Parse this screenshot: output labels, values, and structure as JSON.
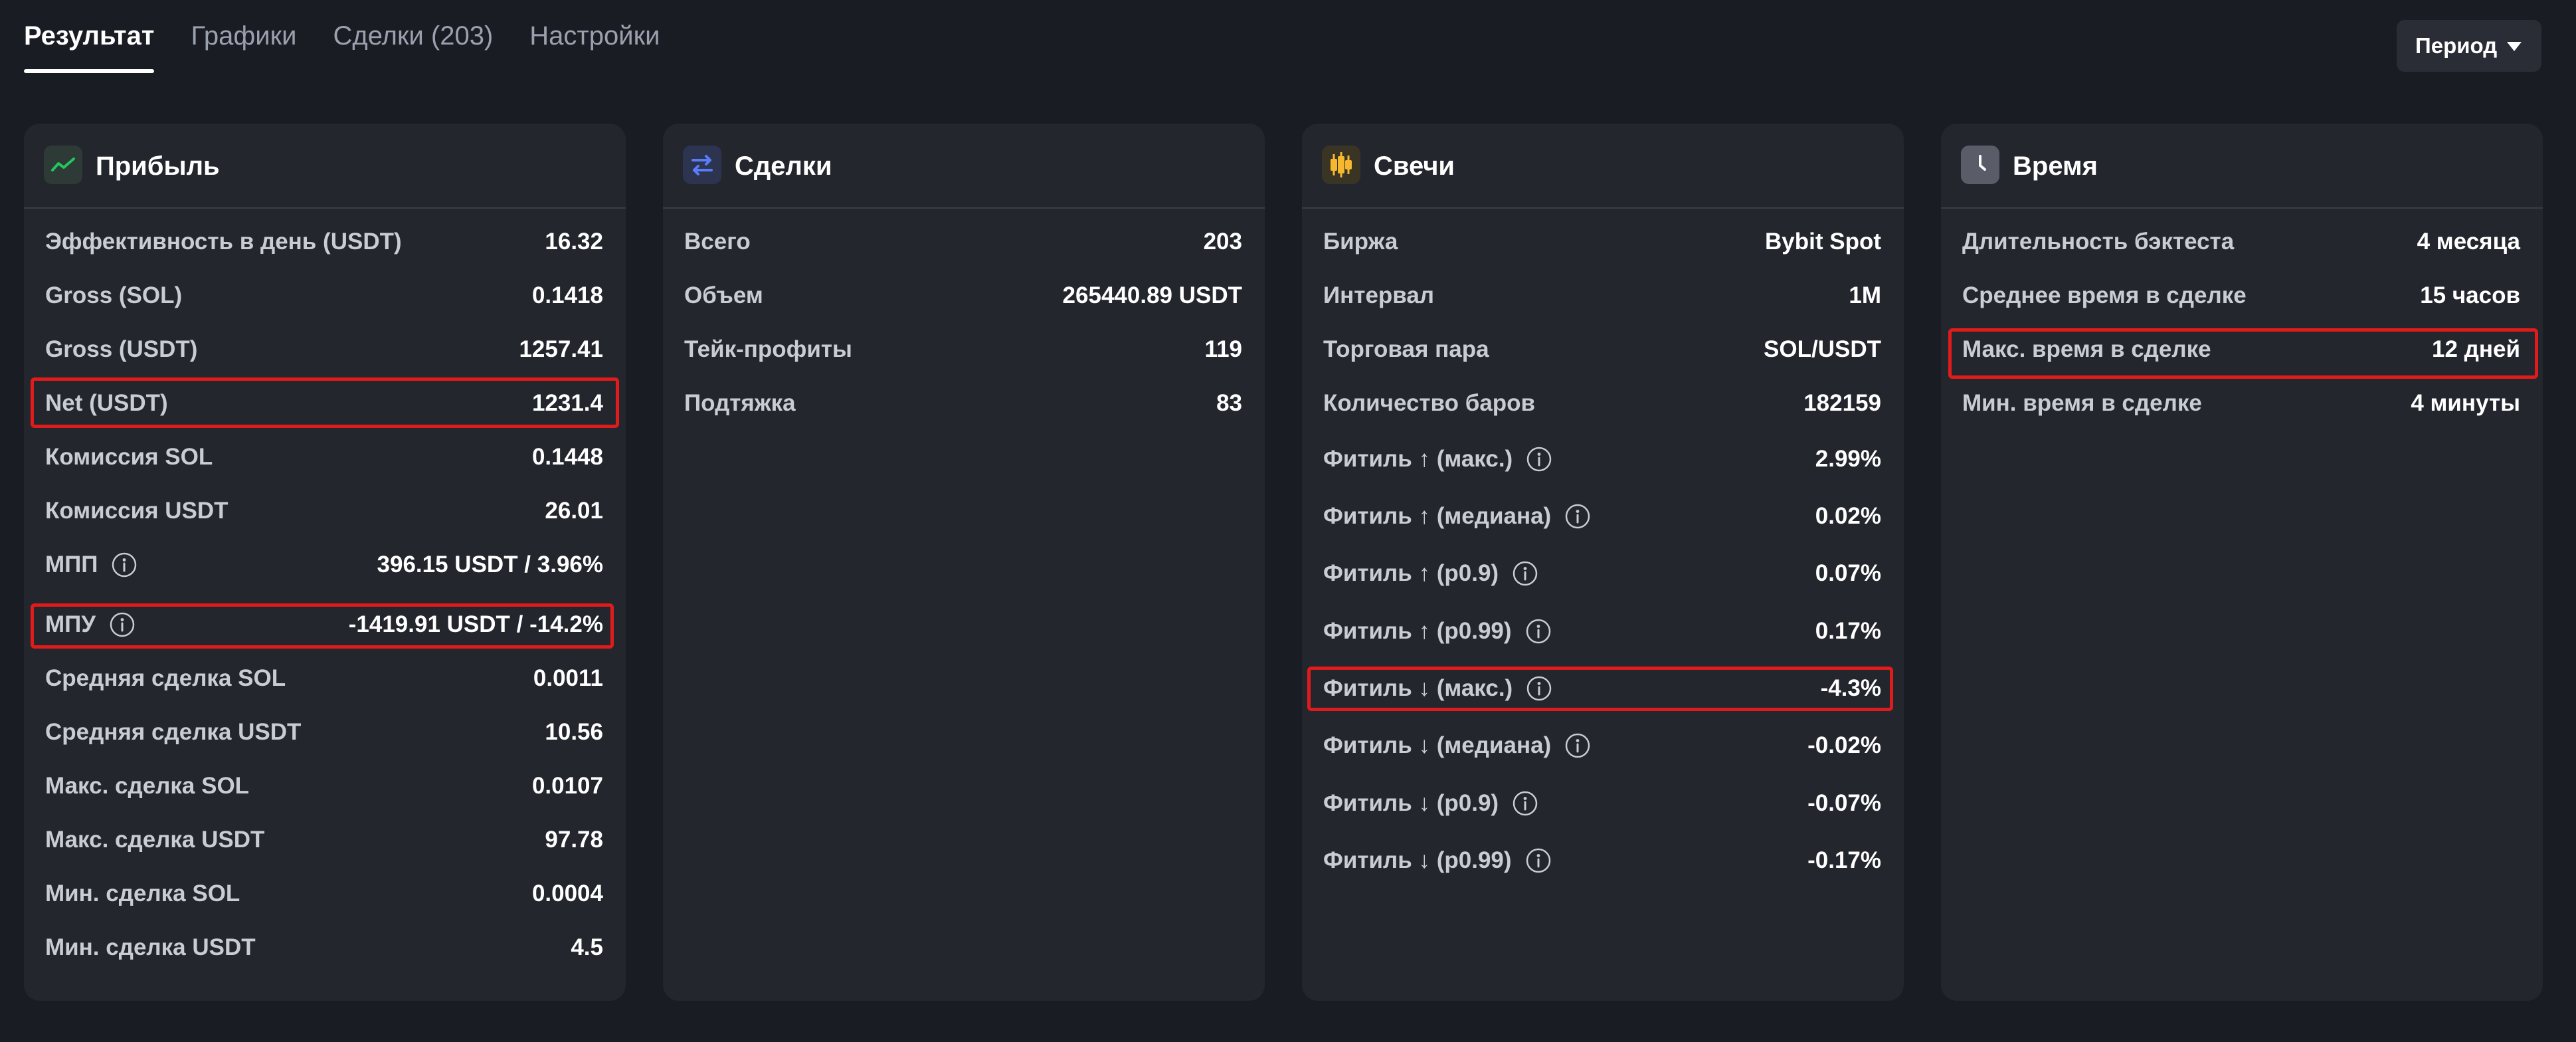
{
  "tabs": [
    {
      "label": "Результат"
    },
    {
      "label": "Графики"
    },
    {
      "label": "Сделки (203)"
    },
    {
      "label": "Настройки"
    }
  ],
  "period": {
    "label": "Период"
  },
  "cards": {
    "profit": {
      "title": "Прибыль",
      "icon": "trend-up-icon",
      "rows": [
        {
          "label": "Эффективность в день (USDT)",
          "value": "16.32"
        },
        {
          "label": "Gross (SOL)",
          "value": "0.1418"
        },
        {
          "label": "Gross (USDT)",
          "value": "1257.41"
        },
        {
          "label": "Net (USDT)",
          "value": "1231.4"
        },
        {
          "label": "Комиссия SOL",
          "value": "0.1448"
        },
        {
          "label": "Комиссия USDT",
          "value": "26.01"
        },
        {
          "label": "МПП",
          "value": "396.15 USDT / 3.96%"
        },
        {
          "label": "МПУ",
          "value": "-1419.91 USDT / -14.2%"
        },
        {
          "label": "Средняя сделка SOL",
          "value": "0.0011"
        },
        {
          "label": "Средняя сделка USDT",
          "value": "10.56"
        },
        {
          "label": "Макс. сделка SOL",
          "value": "0.0107"
        },
        {
          "label": "Макс. сделка USDT",
          "value": "97.78"
        },
        {
          "label": "Мин. сделка SOL",
          "value": "0.0004"
        },
        {
          "label": "Мин. сделка USDT",
          "value": "4.5"
        }
      ]
    },
    "deals": {
      "title": "Сделки",
      "icon": "swap-arrows-icon",
      "rows": [
        {
          "label": "Всего",
          "value": "203"
        },
        {
          "label": "Объем",
          "value": "265440.89 USDT"
        },
        {
          "label": "Тейк-профиты",
          "value": "119"
        },
        {
          "label": "Подтяжка",
          "value": "83"
        }
      ]
    },
    "candles": {
      "title": "Свечи",
      "icon": "candles-icon",
      "rows": [
        {
          "label": "Биржа",
          "value": "Bybit Spot"
        },
        {
          "label": "Интервал",
          "value": "1M"
        },
        {
          "label": "Торговая пара",
          "value": "SOL/USDT"
        },
        {
          "label": "Количество баров",
          "value": "182159"
        },
        {
          "label": "Фитиль ↑ (макс.)",
          "value": "2.99%"
        },
        {
          "label": "Фитиль ↑ (медиана)",
          "value": "0.02%"
        },
        {
          "label": "Фитиль ↑ (p0.9)",
          "value": "0.07%"
        },
        {
          "label": "Фитиль ↑ (p0.99)",
          "value": "0.17%"
        },
        {
          "label": "Фитиль ↓ (макс.)",
          "value": "-4.3%"
        },
        {
          "label": "Фитиль ↓ (медиана)",
          "value": "-0.02%"
        },
        {
          "label": "Фитиль ↓ (p0.9)",
          "value": "-0.07%"
        },
        {
          "label": "Фитиль ↓ (p0.99)",
          "value": "-0.17%"
        }
      ]
    },
    "time": {
      "title": "Время",
      "icon": "clock-icon",
      "rows": [
        {
          "label": "Длительность бэктеста",
          "value": "4 месяца"
        },
        {
          "label": "Среднее время в сделке",
          "value": "15 часов"
        },
        {
          "label": "Макс. время в сделке",
          "value": "12 дней"
        },
        {
          "label": "Мин. время в сделке",
          "value": "4 минуты"
        }
      ]
    }
  },
  "colors": {
    "background": "#1a1c23",
    "card": "#24262e",
    "highlight": "#e01b1b",
    "profit_icon": "#22c55e",
    "deals_icon": "#5b7cfa",
    "candles_icon": "#f5b82e"
  }
}
